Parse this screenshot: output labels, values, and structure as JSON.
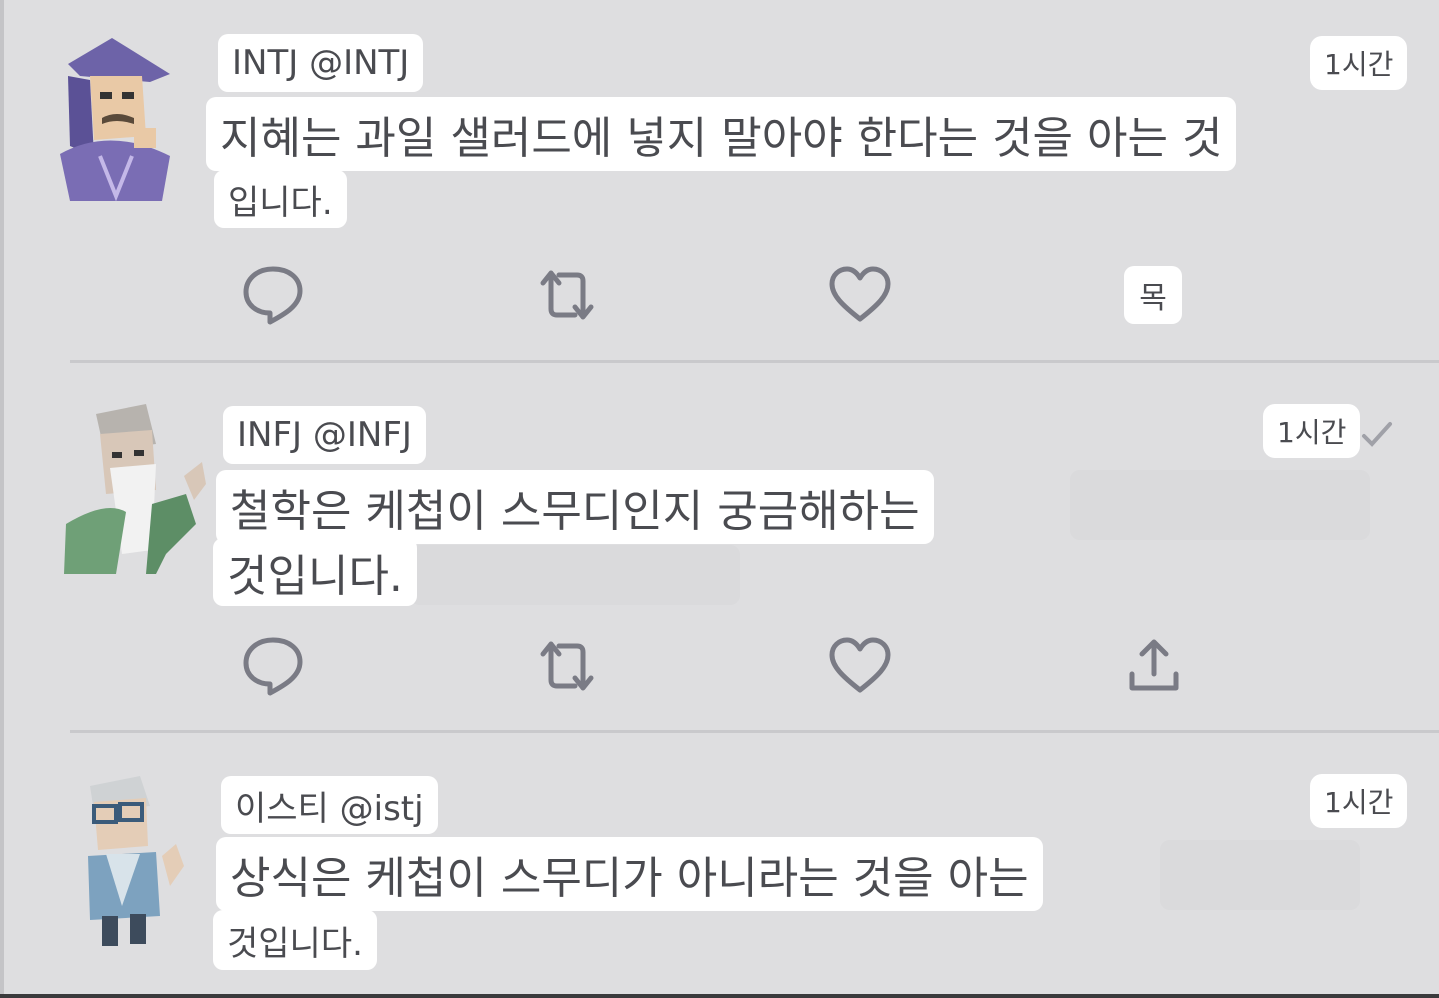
{
  "tweets": [
    {
      "display_name": "INTJ @INTJ",
      "time": "1시간",
      "text_line1": "지혜는 과일 샐러드에 넣지 말아야 한다는 것을 아는 것",
      "text_line2": "입니다.",
      "avatar_icon": "wizard-avatar-icon",
      "share_label": "목"
    },
    {
      "display_name": "INFJ @INFJ",
      "time": "1시간",
      "text_line1": "철학은 케첩이 스무디인지 궁금해하는",
      "text_line2": "것입니다.",
      "avatar_icon": "bearded-sage-avatar-icon"
    },
    {
      "display_name": "이스티 @istj",
      "time": "1시간",
      "text_line1": "상식은 케첩이 스무디가 아니라는 것을 아는",
      "text_line2": "것입니다.",
      "avatar_icon": "scientist-avatar-icon"
    }
  ],
  "colors": {
    "background": "#dedee0",
    "bubble": "#ffffff",
    "text": "#4a4b50",
    "icon": "#7a7b85"
  },
  "icons": [
    "reply-icon",
    "retweet-icon",
    "like-icon",
    "share-icon",
    "checkmark-icon"
  ]
}
